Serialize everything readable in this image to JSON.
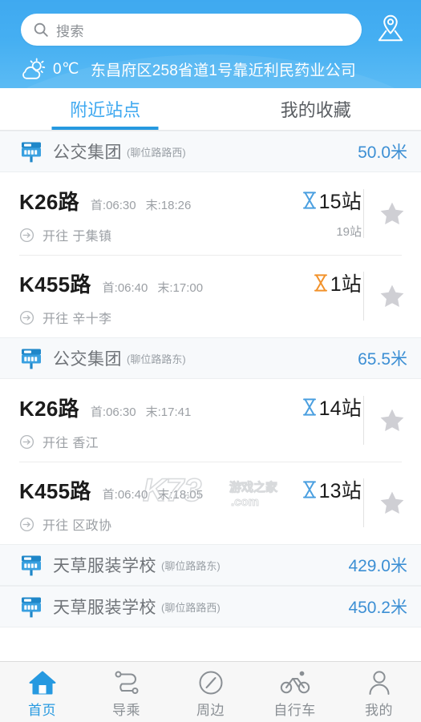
{
  "header": {
    "search": {
      "placeholder": "搜索",
      "icon": "search-icon"
    },
    "location_button_icon": "map-pin-icon",
    "weather": {
      "icon": "sun-behind-cloud-icon",
      "temperature": "0℃",
      "location": "东昌府区258省道1号靠近利民药业公司"
    }
  },
  "tabs": [
    {
      "label": "附近站点",
      "active": true
    },
    {
      "label": "我的收藏",
      "active": false
    }
  ],
  "stations": [
    {
      "icon": "bus-stop-icon",
      "name": "公交集团",
      "sub": "(聊位路路西)",
      "distance": "50.0米",
      "routes": [
        {
          "name": "K26路",
          "first_label": "首:06:30",
          "last_label": "末:18:26",
          "direction_prefix": "开往",
          "direction": "于集镇",
          "eta": "15站",
          "eta_state": "normal",
          "eta_sub": "19站",
          "favorite_icon": "star-icon"
        },
        {
          "name": "K455路",
          "first_label": "首:06:40",
          "last_label": "末:17:00",
          "direction_prefix": "开往",
          "direction": "辛十李",
          "eta": "1站",
          "eta_state": "arriving",
          "eta_sub": "",
          "favorite_icon": "star-icon"
        }
      ]
    },
    {
      "icon": "bus-stop-icon",
      "name": "公交集团",
      "sub": "(聊位路路东)",
      "distance": "65.5米",
      "routes": [
        {
          "name": "K26路",
          "first_label": "首:06:30",
          "last_label": "末:17:41",
          "direction_prefix": "开往",
          "direction": "香江",
          "eta": "14站",
          "eta_state": "normal",
          "eta_sub": "",
          "favorite_icon": "star-icon"
        },
        {
          "name": "K455路",
          "first_label": "首:06:40",
          "last_label": "末:18:05",
          "direction_prefix": "开往",
          "direction": "区政协",
          "eta": "13站",
          "eta_state": "normal",
          "eta_sub": "",
          "favorite_icon": "star-icon"
        }
      ]
    },
    {
      "icon": "bus-stop-icon",
      "name": "天草服装学校",
      "sub": "(聊位路路东)",
      "distance": "429.0米",
      "routes": []
    },
    {
      "icon": "bus-stop-icon",
      "name": "天草服装学校",
      "sub": "(聊位路路西)",
      "distance": "450.2米",
      "routes": []
    }
  ],
  "watermark": {
    "main": "K73",
    "sub": "游戏之家",
    "domain": ".com"
  },
  "bottom_nav": [
    {
      "label": "首页",
      "icon": "home-icon",
      "active": true
    },
    {
      "label": "导乘",
      "icon": "route-icon",
      "active": false
    },
    {
      "label": "周边",
      "icon": "compass-icon",
      "active": false
    },
    {
      "label": "自行车",
      "icon": "bicycle-icon",
      "active": false
    },
    {
      "label": "我的",
      "icon": "person-icon",
      "active": false
    }
  ],
  "colors": {
    "brand_blue": "#3FA9F0",
    "accent_blue": "#2699e0",
    "distance_blue": "#3C8FD4",
    "eta_blue": "#4A9FE0",
    "eta_orange": "#F2922B",
    "star_gray": "#CFCFD4"
  }
}
